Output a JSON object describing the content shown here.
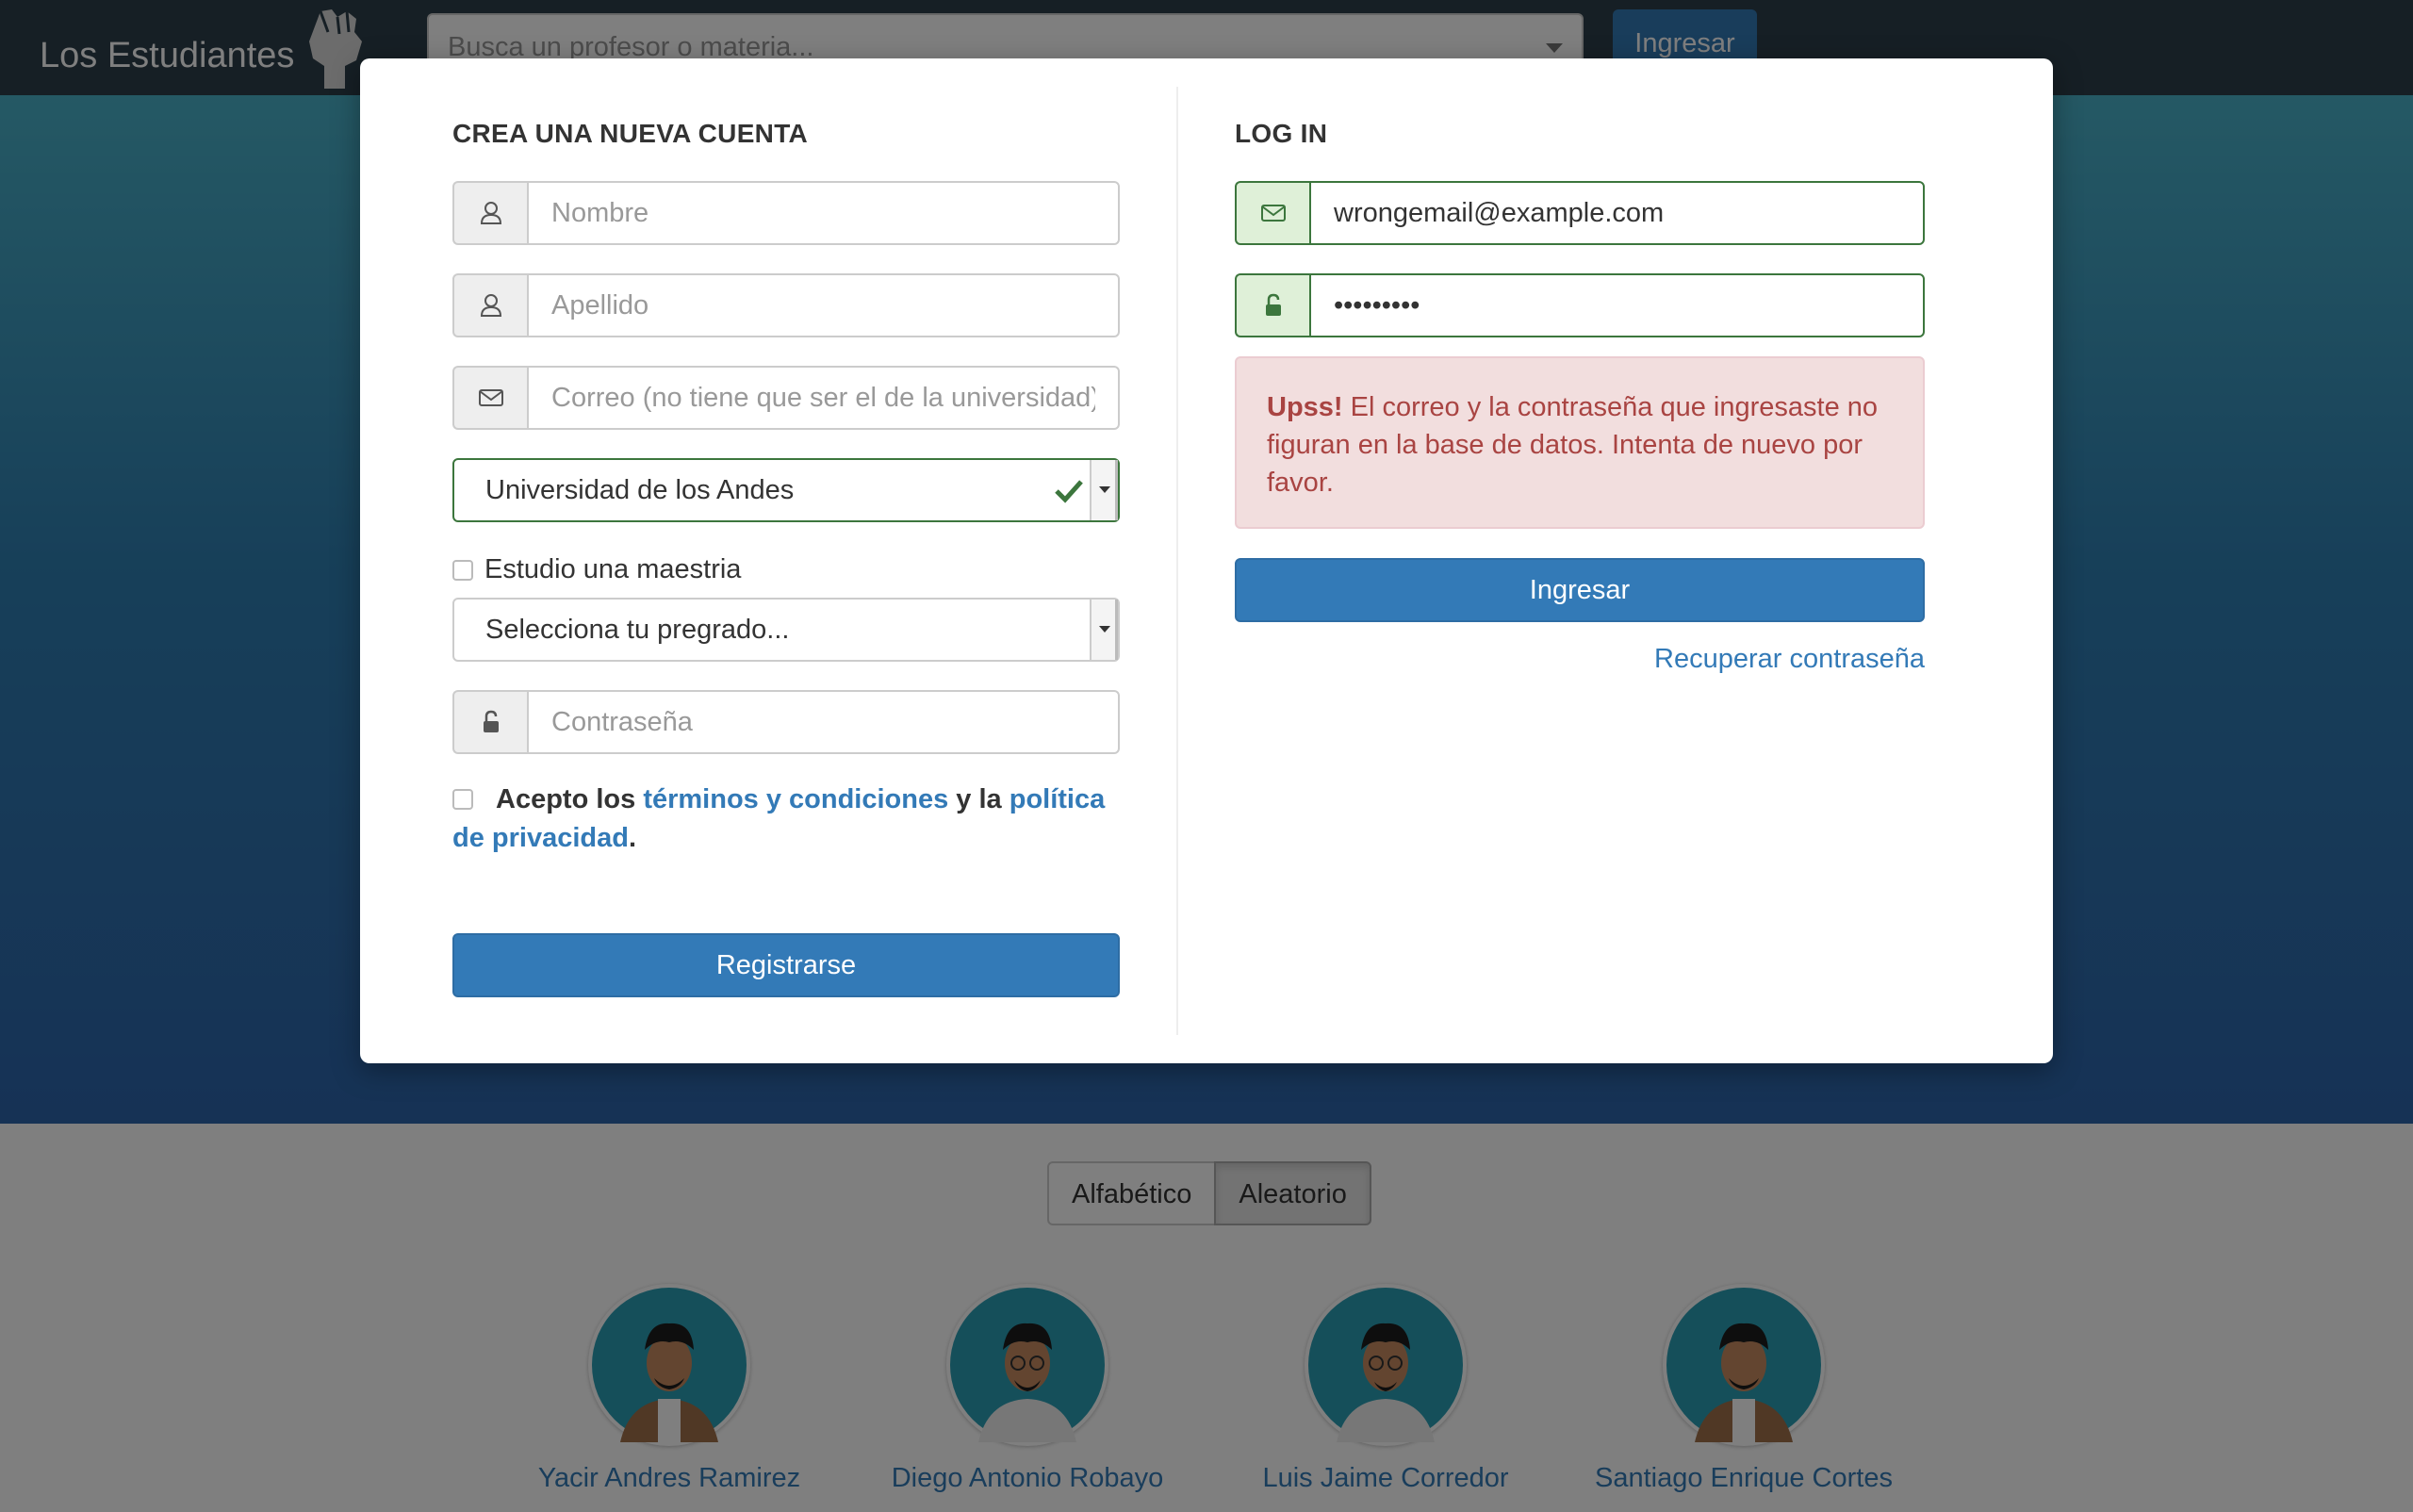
{
  "navbar": {
    "brand": "Los Estudiantes",
    "search_placeholder": "Busca un profesor o materia...",
    "login_button": "Ingresar"
  },
  "sort": {
    "alphabetical": "Alfabético",
    "random": "Aleatorio",
    "active": "Aleatorio"
  },
  "professors": [
    {
      "name": "Yacir Andres Ramirez"
    },
    {
      "name": "Diego Antonio Robayo"
    },
    {
      "name": "Luis Jaime Corredor"
    },
    {
      "name": "Santiago Enrique Cortes"
    }
  ],
  "register": {
    "title": "CREA UNA NUEVA CUENTA",
    "first_name_placeholder": "Nombre",
    "last_name_placeholder": "Apellido",
    "email_placeholder": "Correo (no tiene que ser el de la universidad)",
    "university_value": "Universidad de los Andes",
    "masters_label": "Estudio una maestria",
    "program_placeholder": "Selecciona tu pregrado...",
    "password_placeholder": "Contraseña",
    "terms_prefix": "Acepto los ",
    "terms_link": "términos y condiciones",
    "terms_middle": " y la ",
    "privacy_link": "política de privacidad",
    "terms_suffix": ".",
    "submit_label": "Registrarse"
  },
  "login": {
    "title": "LOG IN",
    "email_value": "wrongemail@example.com",
    "password_value": "•••••••••",
    "error_strong": "Upss!",
    "error_text": " El correo y la contraseña que ingresaste no figuran en la base de datos. Intenta de nuevo por favor.",
    "submit_label": "Ingresar",
    "recover_label": "Recuperar contraseña"
  },
  "colors": {
    "primary": "#337ab7",
    "success": "#3c763d",
    "danger": "#a94442",
    "navbar": "#2d3e4a"
  },
  "icons": {
    "user": "user-icon",
    "envelope": "envelope-icon",
    "lock": "lock-icon",
    "check": "check-icon",
    "fist": "fist-logo-icon"
  }
}
